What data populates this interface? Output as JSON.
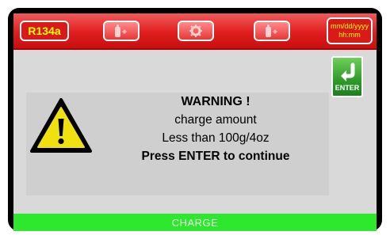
{
  "topbar": {
    "refrigerant": "R134a",
    "icons": [
      "refrigerant-tank-icon",
      "gear-icon",
      "refrigerant-tank-icon"
    ],
    "date_format": "mm/dd/yyyy",
    "time_format": "hh:mm"
  },
  "dialog": {
    "title": "WARNING !",
    "line1": "charge amount",
    "line2": "Less than 100g/4oz",
    "line3": "Press ENTER to continue",
    "icon": "warning-triangle-icon"
  },
  "enter_button": {
    "label": "ENTER",
    "icon": "enter-arrow-icon"
  },
  "status_bar": {
    "label": "CHARGE"
  },
  "colors": {
    "topbar_red": "#e01e1e",
    "chip_text_yellow": "#ffff00",
    "status_green": "#2ee82e",
    "enter_green": "#2e9a2a",
    "screen_gray": "#d9d9d9"
  }
}
